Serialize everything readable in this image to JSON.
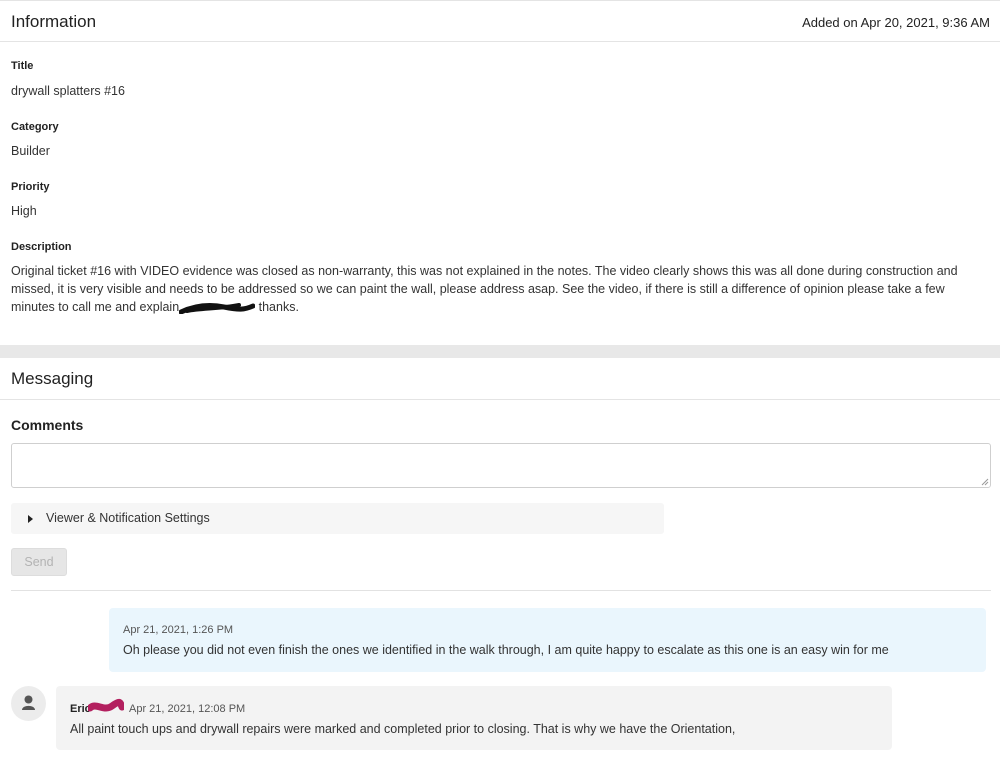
{
  "information": {
    "title": "Information",
    "added": "Added on Apr 20, 2021, 9:36 AM",
    "fields": [
      {
        "label": "Title",
        "value": "drywall splatters #16"
      },
      {
        "label": "Category",
        "value": "Builder"
      },
      {
        "label": "Priority",
        "value": "High"
      }
    ],
    "description_label": "Description",
    "description_text": "Original ticket #16 with VIDEO evidence was closed as non-warranty, this was not explained in the notes. The video clearly shows this was all done during construction and missed, it is very visible and needs to be addressed so we can paint the wall, please address asap. See the video, if there is still a difference of opinion please take a few minutes to call me and explain",
    "description_tail": " thanks."
  },
  "messaging": {
    "title": "Messaging",
    "comments_label": "Comments",
    "comment_value": "",
    "settings_label": "Viewer & Notification Settings",
    "send_label": "Send",
    "messages": [
      {
        "timestamp": "Apr 21, 2021, 1:26 PM",
        "text": "Oh please you did not even finish the ones we identified in the walk through, I am quite happy to escalate as this one is an easy win for me"
      },
      {
        "author": "Eric",
        "timestamp": "Apr 21, 2021, 12:08 PM",
        "text": "All paint touch ups and drywall repairs were marked and completed prior to closing. That is why we have the Orientation,"
      }
    ]
  },
  "colors": {
    "outgoing_bubble": "#eaf6fd",
    "incoming_bubble": "#f3f3f3",
    "redaction_black": "#111111",
    "redaction_magenta": "#b3205f"
  },
  "icons": {
    "settings_toggle": "caret-right-icon",
    "avatar": "user-icon"
  }
}
